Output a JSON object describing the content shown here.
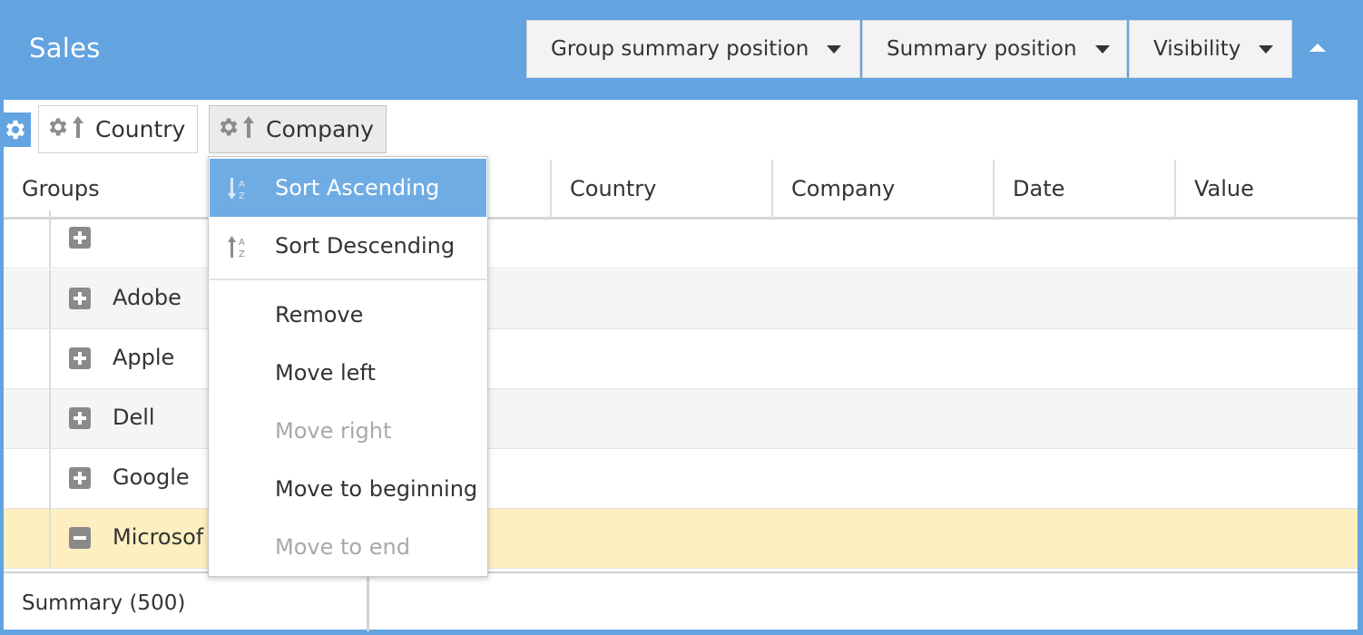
{
  "window": {
    "title": "Sales"
  },
  "toolbar": {
    "group_summary_position": "Group summary position",
    "summary_position": "Summary position",
    "visibility": "Visibility"
  },
  "group_chips": [
    {
      "label": "Country"
    },
    {
      "label": "Company"
    }
  ],
  "columns": [
    "Groups",
    "Country",
    "Company",
    "Date",
    "Value"
  ],
  "rows": [
    {
      "label": "",
      "state": "collapsed"
    },
    {
      "label": "Adobe",
      "state": "collapsed"
    },
    {
      "label": "Apple",
      "state": "collapsed"
    },
    {
      "label": "Dell",
      "state": "collapsed"
    },
    {
      "label": "Google",
      "state": "collapsed"
    },
    {
      "label": "Microsof",
      "state": "expanded",
      "selected": true
    }
  ],
  "summary": {
    "label": "Summary (500)"
  },
  "context_menu": {
    "items": [
      {
        "label": "Sort Ascending",
        "icon": "sort-ascending-icon",
        "highlighted": true
      },
      {
        "label": "Sort Descending",
        "icon": "sort-descending-icon"
      },
      {
        "label": "Remove"
      },
      {
        "label": "Move left"
      },
      {
        "label": "Move right",
        "disabled": true
      },
      {
        "label": "Move to beginning"
      },
      {
        "label": "Move to end",
        "disabled": true
      }
    ]
  },
  "colors": {
    "header_blue": "#62a3e0",
    "menu_highlight": "#70ace4",
    "selected_row": "#fdefc0",
    "alt_row": "#f5f5f5"
  }
}
